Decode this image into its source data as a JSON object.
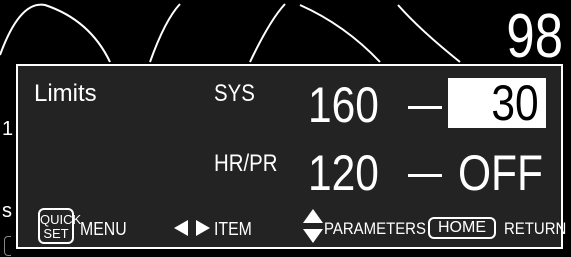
{
  "background": {
    "value": "98",
    "fragment_a": "1",
    "fragment_b": "s"
  },
  "panel": {
    "title": "Limits",
    "rows": [
      {
        "label": "SYS",
        "high": "160",
        "low": "30",
        "low_selected": true
      },
      {
        "label": "HR/PR",
        "high": "120",
        "low": "OFF",
        "low_selected": false
      }
    ]
  },
  "footer": {
    "quick_key_line1": "QUICK",
    "quick_key_line2": "SET",
    "menu_label": "MENU",
    "lr_arrows_icon": "left-right-triangle-arrows-icon",
    "item_label": "ITEM",
    "ud_arrows_icon": "up-down-triangle-arrows-icon",
    "parameters_label": "PARAMETERS",
    "home_key": "HOME",
    "return_label": "RETURN"
  },
  "colors": {
    "panel_bg": "#232323",
    "background": "#000000",
    "text": "#ffffff",
    "selected_bg": "#ffffff",
    "selected_text": "#000000"
  }
}
